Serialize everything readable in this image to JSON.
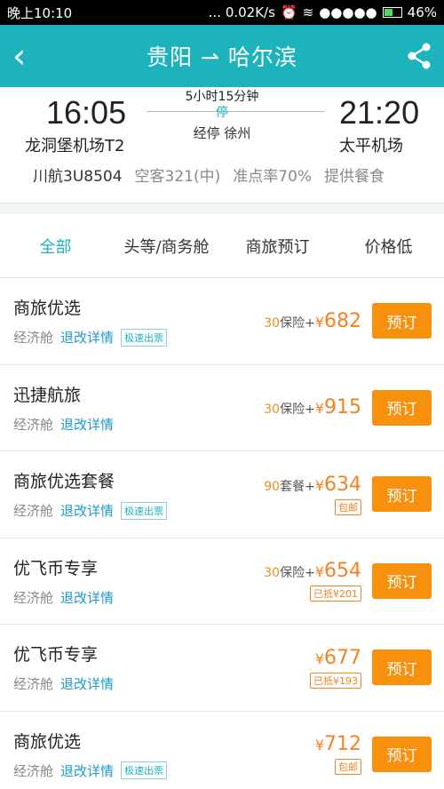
{
  "status": {
    "time": "晚上10:10",
    "speed": "... 0.02K/s",
    "signal": "●●●●●",
    "battery": "46%"
  },
  "header": {
    "title": "贵阳 ⇀ 哈尔滨"
  },
  "flight": {
    "dep_time": "16:05",
    "arr_time": "21:20",
    "dep_airport": "龙洞堡机场T2",
    "arr_airport": "太平机场",
    "duration": "5小时15分钟",
    "stop_label": "停",
    "stop_city": "经停 徐州",
    "flight_no": "川航3U8504",
    "aircraft": "空客321(中)",
    "ontime": "准点率70%",
    "meal": "提供餐食"
  },
  "tabs": [
    "全部",
    "头等/商务舱",
    "商旅预订",
    "价格低"
  ],
  "items": [
    {
      "name": "商旅优选",
      "cabin": "经济舱",
      "refund": "退改详情",
      "fast": "极速出票",
      "extra": "30",
      "extra_label": "保险+",
      "yen": "¥",
      "price": "682",
      "tag": "",
      "book": "预订"
    },
    {
      "name": "迅捷航旅",
      "cabin": "经济舱",
      "refund": "退改详情",
      "fast": "",
      "extra": "30",
      "extra_label": "保险+",
      "yen": "¥",
      "price": "915",
      "tag": "",
      "book": "预订"
    },
    {
      "name": "商旅优选套餐",
      "cabin": "经济舱",
      "refund": "退改详情",
      "fast": "极速出票",
      "extra": "90",
      "extra_label": "套餐+",
      "yen": "¥",
      "price": "634",
      "tag": "包邮",
      "book": "预订"
    },
    {
      "name": "优飞币专享",
      "cabin": "经济舱",
      "refund": "退改详情",
      "fast": "",
      "extra": "30",
      "extra_label": "保险+",
      "yen": "¥",
      "price": "654",
      "tag": "已抵¥201",
      "book": "预订"
    },
    {
      "name": "优飞币专享",
      "cabin": "经济舱",
      "refund": "退改详情",
      "fast": "",
      "extra": "",
      "extra_label": "",
      "yen": "¥",
      "price": "677",
      "tag": "已抵¥193",
      "book": "预订"
    },
    {
      "name": "商旅优选",
      "cabin": "经济舱",
      "refund": "退改详情",
      "fast": "极速出票",
      "extra": "",
      "extra_label": "",
      "yen": "¥",
      "price": "712",
      "tag": "包邮",
      "book": "预订"
    }
  ]
}
